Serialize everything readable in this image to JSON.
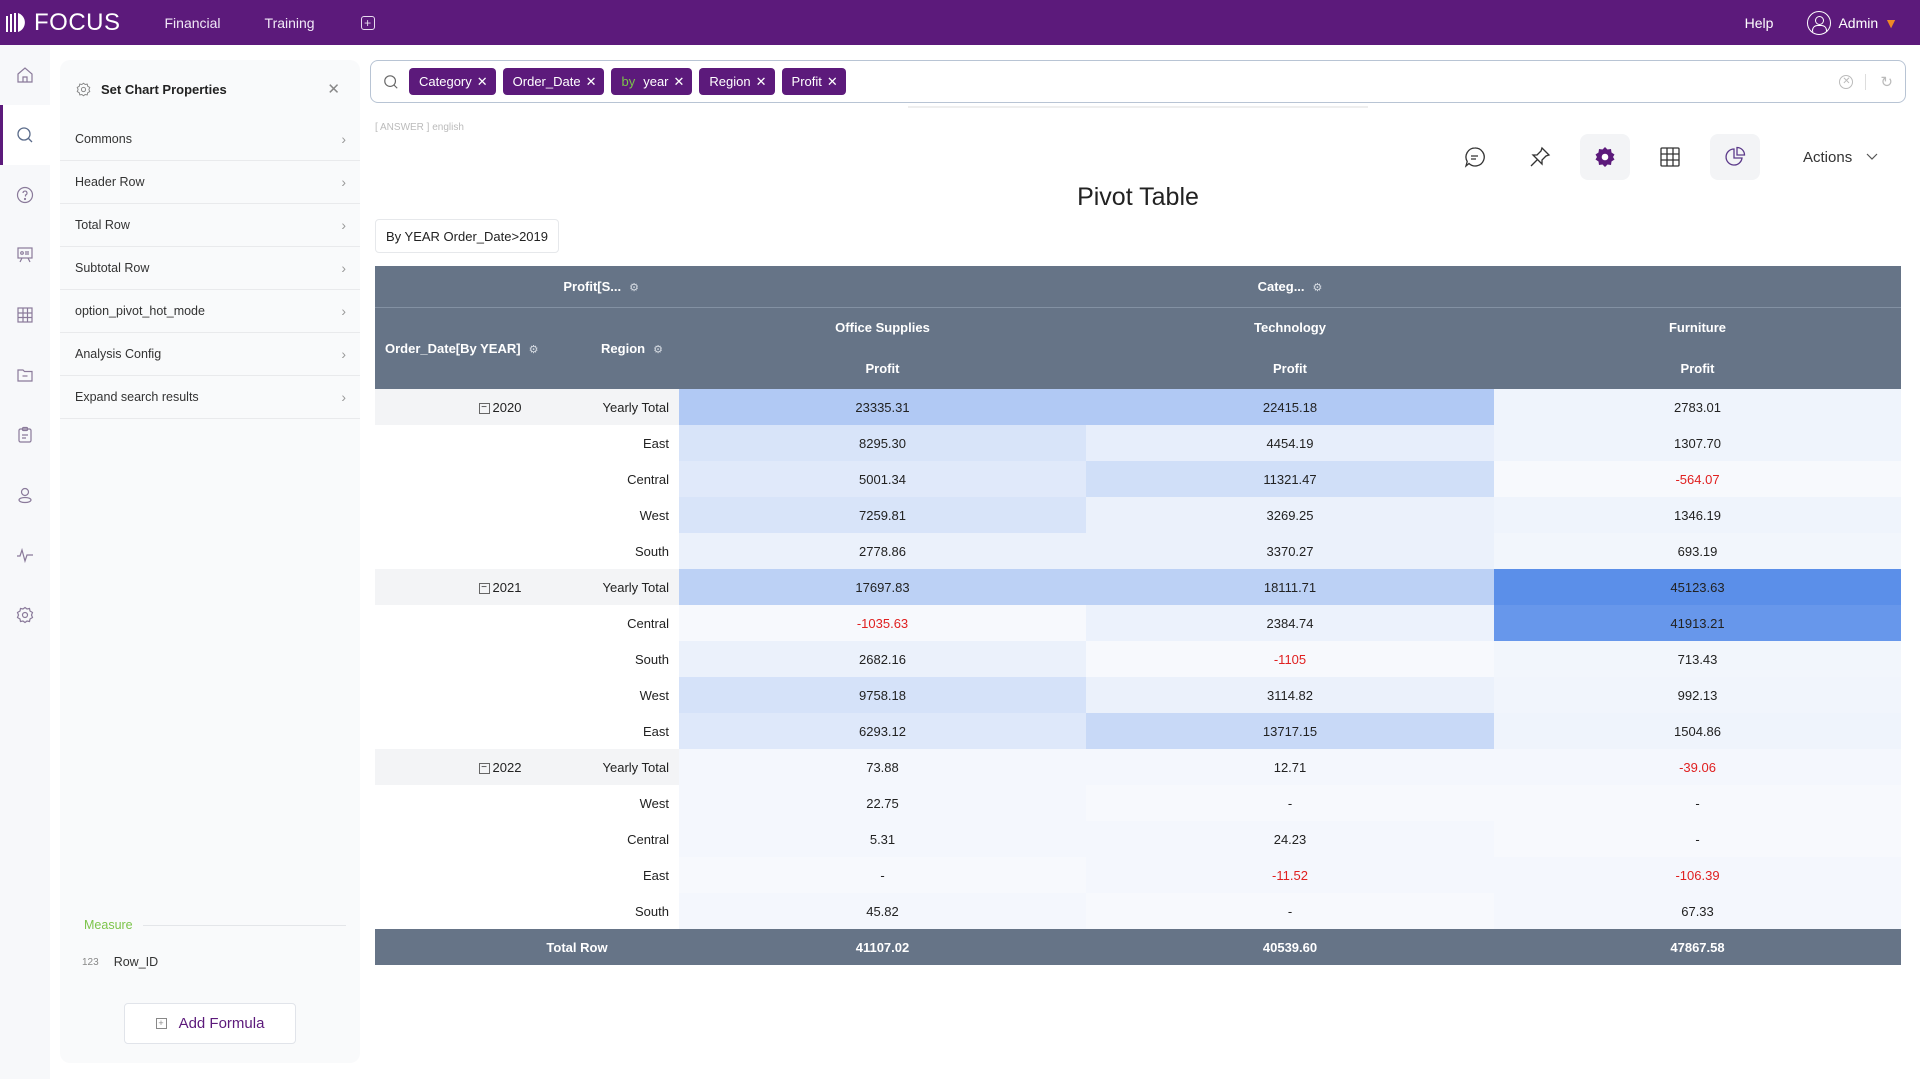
{
  "app": {
    "logo": "FOCUS",
    "nav": [
      "Financial",
      "Training"
    ],
    "help": "Help",
    "user": "Admin"
  },
  "iconbar": [
    "home-icon",
    "search-icon",
    "help-circle-icon",
    "presentation-icon",
    "table-icon",
    "folder-icon",
    "clipboard-icon",
    "user-icon",
    "pulse-icon",
    "settings-icon"
  ],
  "props": {
    "title": "Set Chart Properties",
    "items": [
      "Commons",
      "Header Row",
      "Total Row",
      "Subtotal Row",
      "option_pivot_hot_mode",
      "Analysis Config",
      "Expand search results"
    ],
    "measure_label": "Measure",
    "field_type": "123",
    "field_name": "Row_ID",
    "add_formula": "Add Formula"
  },
  "search": {
    "chips": [
      {
        "prefix": "",
        "label": "Category"
      },
      {
        "prefix": "",
        "label": "Order_Date"
      },
      {
        "prefix": "by",
        "label": "year"
      },
      {
        "prefix": "",
        "label": "Region"
      },
      {
        "prefix": "",
        "label": "Profit"
      }
    ],
    "answer_hint": "[ ANSWER ] english"
  },
  "toolbar": {
    "actions": "Actions"
  },
  "chart_data": {
    "type": "table",
    "title": "Pivot Table",
    "filter": "By YEAR Order_Date>2019",
    "header": {
      "measure_corner": "Profit[S...",
      "category_field": "Categ...",
      "row_fields": [
        "Order_Date[By YEAR]",
        "Region"
      ],
      "categories": [
        "Office Supplies",
        "Technology",
        "Furniture"
      ],
      "measure": "Profit"
    },
    "groups": [
      {
        "year": "2020",
        "rows": [
          {
            "region": "Yearly Total",
            "values": [
              "23335.31",
              "22415.18",
              "2783.01"
            ],
            "shade": [
              0.45,
              0.45,
              0.05
            ]
          },
          {
            "region": "East",
            "values": [
              "8295.30",
              "4454.19",
              "1307.70"
            ],
            "shade": [
              0.2,
              0.1,
              0.05
            ]
          },
          {
            "region": "Central",
            "values": [
              "5001.34",
              "11321.47",
              "-564.07"
            ],
            "shade": [
              0.15,
              0.25,
              0
            ]
          },
          {
            "region": "West",
            "values": [
              "7259.81",
              "3269.25",
              "1346.19"
            ],
            "shade": [
              0.2,
              0.08,
              0.05
            ]
          },
          {
            "region": "South",
            "values": [
              "2778.86",
              "3370.27",
              "693.19"
            ],
            "shade": [
              0.08,
              0.08,
              0.03
            ]
          }
        ]
      },
      {
        "year": "2021",
        "rows": [
          {
            "region": "Yearly Total",
            "values": [
              "17697.83",
              "18111.71",
              "45123.63"
            ],
            "shade": [
              0.38,
              0.38,
              1.0
            ]
          },
          {
            "region": "Central",
            "values": [
              "-1035.63",
              "2384.74",
              "41913.21"
            ],
            "shade": [
              0,
              0.07,
              0.92
            ]
          },
          {
            "region": "South",
            "values": [
              "2682.16",
              "-1105",
              "713.43"
            ],
            "shade": [
              0.08,
              0,
              0.03
            ]
          },
          {
            "region": "West",
            "values": [
              "9758.18",
              "3114.82",
              "992.13"
            ],
            "shade": [
              0.22,
              0.08,
              0.04
            ]
          },
          {
            "region": "East",
            "values": [
              "6293.12",
              "13717.15",
              "1504.86"
            ],
            "shade": [
              0.16,
              0.3,
              0.05
            ]
          }
        ]
      },
      {
        "year": "2022",
        "rows": [
          {
            "region": "Yearly Total",
            "values": [
              "73.88",
              "12.71",
              "-39.06"
            ],
            "shade": [
              0.02,
              0.02,
              0.02
            ]
          },
          {
            "region": "West",
            "values": [
              "22.75",
              "-",
              "-"
            ],
            "shade": [
              0.02,
              0,
              0
            ]
          },
          {
            "region": "Central",
            "values": [
              "5.31",
              "24.23",
              "-"
            ],
            "shade": [
              0.02,
              0.02,
              0
            ]
          },
          {
            "region": "East",
            "values": [
              "-",
              "-11.52",
              "-106.39"
            ],
            "shade": [
              0,
              0.02,
              0.02
            ]
          },
          {
            "region": "South",
            "values": [
              "45.82",
              "-",
              "67.33"
            ],
            "shade": [
              0.02,
              0,
              0.02
            ]
          }
        ]
      }
    ],
    "total": {
      "label": "Total Row",
      "values": [
        "41107.02",
        "40539.60",
        "47867.58"
      ]
    }
  }
}
